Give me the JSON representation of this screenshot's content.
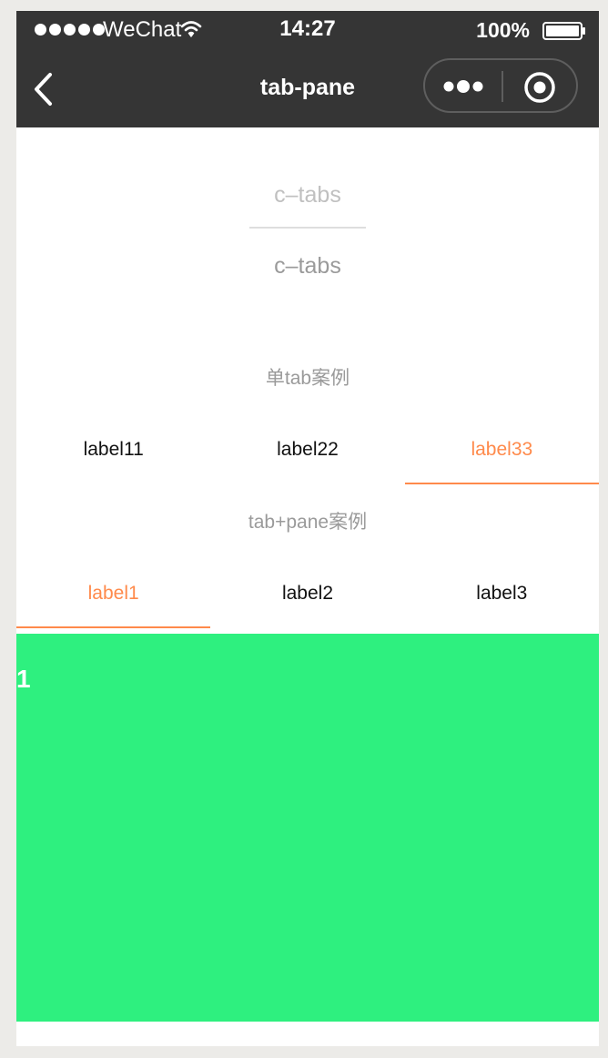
{
  "status_bar": {
    "carrier": "WeChat",
    "time": "14:27",
    "battery": "100%",
    "icons": [
      "signal-icon",
      "wifi-icon",
      "battery-icon"
    ]
  },
  "nav": {
    "title": "tab-pane",
    "icons": [
      "back-icon",
      "more-icon",
      "close-mini-icon"
    ]
  },
  "demo": {
    "title_top": "c–tabs",
    "title_bottom": "c–tabs"
  },
  "single_tab": {
    "section_title": "单tab案例",
    "tabs": [
      {
        "label": "label11",
        "active": false
      },
      {
        "label": "label22",
        "active": false
      },
      {
        "label": "label33",
        "active": true
      }
    ]
  },
  "tab_pane": {
    "section_title": "tab+pane案例",
    "tabs": [
      {
        "label": "label1",
        "active": true
      },
      {
        "label": "label2",
        "active": false
      },
      {
        "label": "label3",
        "active": false
      }
    ],
    "pane_content": "1"
  },
  "colors": {
    "active_tab": "#ff8a4b",
    "pane_background": "#2ef07f",
    "header_background": "#353535"
  }
}
